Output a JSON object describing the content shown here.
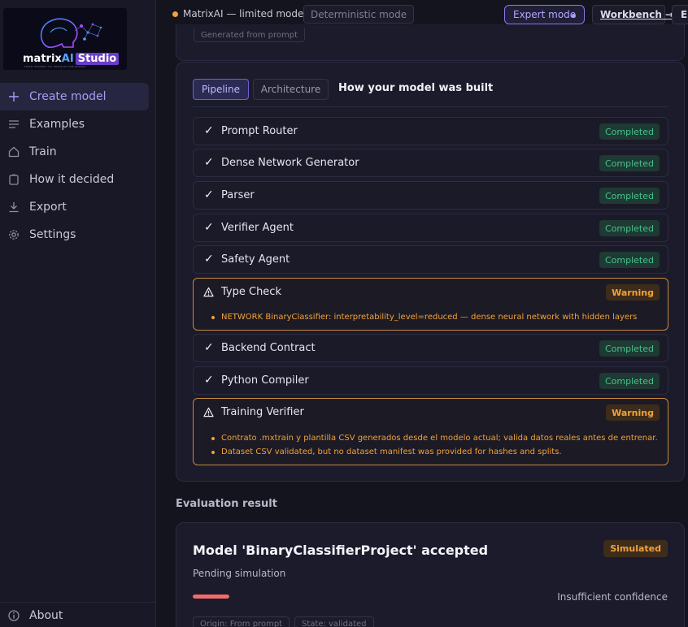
{
  "sidebar": {
    "logo": {
      "word": "matrix",
      "ai": "AI",
      "studio": "Studio",
      "tagline": "FROM PROMPT TO PRODUCTION MODEL"
    },
    "items": [
      {
        "label": "Create model",
        "icon": "plus-icon",
        "active": true
      },
      {
        "label": "Examples",
        "icon": "list-icon",
        "active": false
      },
      {
        "label": "Train",
        "icon": "home-icon",
        "active": false
      },
      {
        "label": "How it decided",
        "icon": "clipboard-icon",
        "active": false
      },
      {
        "label": "Export",
        "icon": "download-icon",
        "active": false
      },
      {
        "label": "Settings",
        "icon": "gear-icon",
        "active": false
      }
    ],
    "about": "About"
  },
  "topbar": {
    "mode_text": "MatrixAI — limited mode",
    "deterministic": "Deterministic mode",
    "expert": "Expert mode",
    "workbench": "Workbench →",
    "lang": "ES"
  },
  "top_card": {
    "generated": "Generated from prompt"
  },
  "pipeline": {
    "tabs": [
      "Pipeline",
      "Architecture"
    ],
    "heading": "How your model was built",
    "steps": [
      {
        "name": "Prompt Router",
        "status": "Completed"
      },
      {
        "name": "Dense Network Generator",
        "status": "Completed"
      },
      {
        "name": "Parser",
        "status": "Completed"
      },
      {
        "name": "Verifier Agent",
        "status": "Completed"
      },
      {
        "name": "Safety Agent",
        "status": "Completed"
      },
      {
        "name": "Type Check",
        "status": "Warning",
        "messages": [
          "NETWORK BinaryClassifier: interpretability_level=reduced — dense neural network with hidden layers"
        ]
      },
      {
        "name": "Backend Contract",
        "status": "Completed"
      },
      {
        "name": "Python Compiler",
        "status": "Completed"
      },
      {
        "name": "Training Verifier",
        "status": "Warning",
        "messages": [
          "Contrato .mxtrain y plantilla CSV generados desde el modelo actual; valida datos reales antes de entrenar.",
          "Dataset CSV validated, but no dataset manifest was provided for hashes and splits."
        ]
      }
    ]
  },
  "evaluation": {
    "section_title": "Evaluation result",
    "title": "Model 'BinaryClassifierProject' accepted",
    "badge": "Simulated",
    "subtitle": "Pending simulation",
    "confidence_fraction": 1.0,
    "confidence_text": "Insufficient confidence",
    "origin": "Origin: From prompt",
    "state": "State: validated"
  },
  "colors": {
    "accent": "#8a78e8",
    "success": "#47c28f",
    "warning": "#f0a23b",
    "danger": "#f26b6b"
  }
}
